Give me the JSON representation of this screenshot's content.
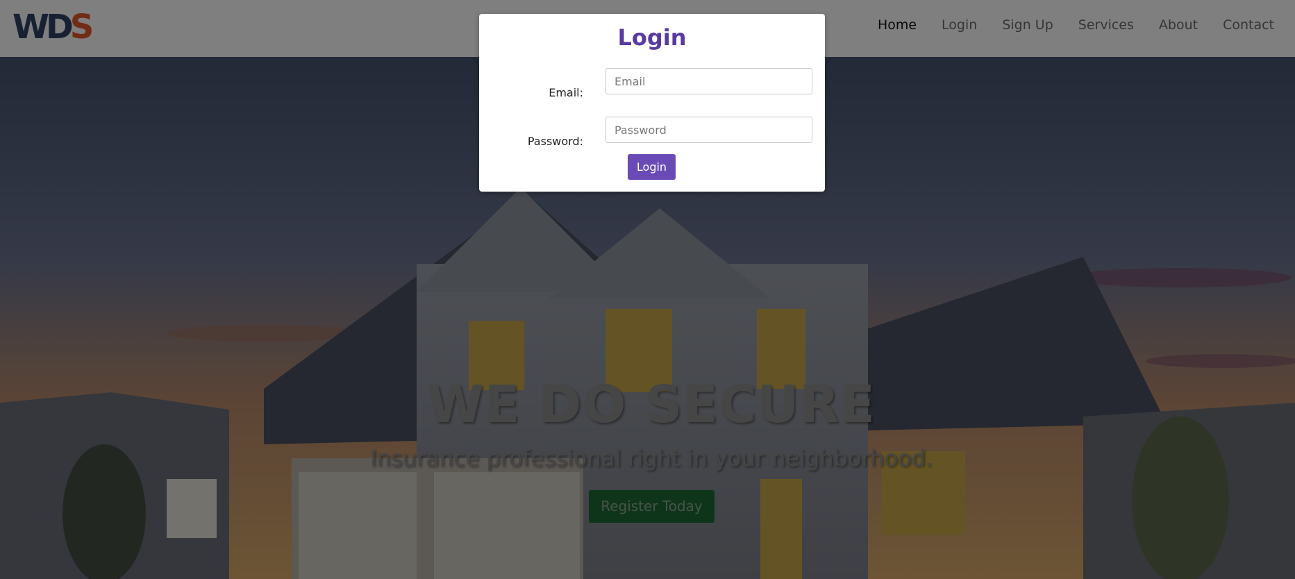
{
  "logo": {
    "w": "W",
    "d": "D",
    "s": "S"
  },
  "nav": {
    "items": [
      {
        "label": "Home",
        "active": true
      },
      {
        "label": "Login",
        "active": false
      },
      {
        "label": "Sign Up",
        "active": false
      },
      {
        "label": "Services",
        "active": false
      },
      {
        "label": "About",
        "active": false
      },
      {
        "label": "Contact",
        "active": false
      }
    ]
  },
  "hero": {
    "title": "WE DO SECURE",
    "subtitle": "Insurance professional right in your neighborhood.",
    "cta_label": "Register Today"
  },
  "login_modal": {
    "title": "Login",
    "email_label": "Email:",
    "email_placeholder": "Email",
    "password_label": "Password:",
    "password_placeholder": "Password",
    "submit_label": "Login"
  },
  "colors": {
    "brand_purple": "#6a4bb5",
    "logo_blue": "#2e4366",
    "logo_orange": "#e2592a",
    "cta_green": "#1d6b34"
  }
}
